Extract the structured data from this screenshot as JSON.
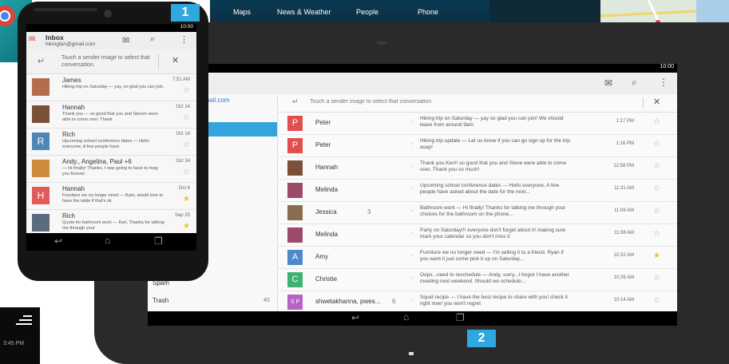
{
  "homescreen": {
    "apps": [
      "Maps",
      "News & Weather",
      "People",
      "Phone"
    ]
  },
  "clock_widget": {
    "time": "3:45 PM"
  },
  "phone": {
    "status_time": "10:00",
    "title": "Inbox",
    "account": "hikingfan@gmail.com",
    "hint": "Touch a sender image to select that conversation.",
    "conversations": [
      {
        "name": "James",
        "date": "7:51 AM",
        "snippet": "Hiking trip on Saturday — yay, so glad you can join.",
        "avatar_letter": "",
        "avatar_color": "#b56d4f",
        "starred": false
      },
      {
        "name": "Hannah",
        "date": "Oct 14",
        "snippet": "Thank you — so good that you and Steven were able to come over. Thank",
        "avatar_letter": "",
        "avatar_color": "#7b5038",
        "starred": false
      },
      {
        "name": "Rich",
        "date": "Oct 14",
        "snippet": "Upcoming school conference dates — Hello everyone, A few people have",
        "avatar_letter": "R",
        "avatar_color": "#4f86b8",
        "starred": false
      },
      {
        "name": "Andy., Angelina, Paul +6",
        "date": "Oct 14",
        "snippet": "— Hi finally! Thanks, I was going to have to mag you forever.",
        "avatar_letter": "",
        "avatar_color": "#d08a3b",
        "starred": false
      },
      {
        "name": "Hannah",
        "date": "Oct 6",
        "snippet": "Furniture we no longer need — Ram, would love to have the table if that's ok",
        "avatar_letter": "H",
        "avatar_color": "#e15a5a",
        "starred": true
      },
      {
        "name": "Rich",
        "date": "Sep 25",
        "snippet": "Quote for bathroom work — Karl, Thanks for talking me through your",
        "avatar_letter": "",
        "avatar_color": "#5a6b7d",
        "starred": true
      }
    ],
    "badge": "1"
  },
  "tablet": {
    "status_time": "10:00",
    "account_partial": "gmail.com",
    "hint": "Touch a sender image to select that conversation.",
    "sidebar": [
      {
        "label": "Spam",
        "count": ""
      },
      {
        "label": "Trash",
        "count": "40"
      }
    ],
    "conversations": [
      {
        "name": "Peter",
        "count": "",
        "time": "1:17 PM",
        "snippet": "Hiking trip on Saturday — yay so glad you can join! We should leave from around 9am.",
        "avatar_letter": "P",
        "avatar_color": "#e04e4e",
        "starred": false,
        "flag": true
      },
      {
        "name": "Peter",
        "count": "",
        "time": "1:16 PM",
        "snippet": "Hiking trip update — Let us know if you can go sign up for the trip asap!",
        "avatar_letter": "P",
        "avatar_color": "#e04e4e",
        "starred": false,
        "flag": true
      },
      {
        "name": "Hannah",
        "count": "",
        "time": "12:58 PM",
        "snippet": "Thank you Ken!! so good that you and Steve were able to come over. Thank you so much!",
        "avatar_letter": "",
        "avatar_color": "#7b5038",
        "starred": false,
        "flag": true
      },
      {
        "name": "Melinda",
        "count": "",
        "time": "11:31 AM",
        "snippet": "Upcoming school conference dates — Hello everyone, A few people have asked about the date for the next...",
        "avatar_letter": "",
        "avatar_color": "#9c4a6a",
        "starred": false,
        "flag": true
      },
      {
        "name": "Jessica",
        "count": "3",
        "time": "11:08 AM",
        "snippet": "Bathroom work — Hi finally! Thanks for talking me through your choices for the bathroom on the phone...",
        "avatar_letter": "",
        "avatar_color": "#8a6d4c",
        "starred": false,
        "flag": true
      },
      {
        "name": "Melinda",
        "count": "",
        "time": "11:08 AM",
        "snippet": "Party on Saturday!!! everyone don't forget about it! making sure mark your calendar so you don't miss it",
        "avatar_letter": "",
        "avatar_color": "#9c4a6a",
        "starred": false,
        "flag": true
      },
      {
        "name": "Amy",
        "count": "",
        "time": "10:32 AM",
        "snippet": "Furniture we no longer need — I'm selling it to a friend. Ryan if you want it just come pick it up on Saturday...",
        "avatar_letter": "A",
        "avatar_color": "#4d8bc6",
        "starred": true,
        "flag": true
      },
      {
        "name": "Christie",
        "count": "",
        "time": "10:26 AM",
        "snippet": "Oops...need to reschedule — Andy, sorry...I forgot I have another meeting next weekend. Should we schedule...",
        "avatar_letter": "C",
        "avatar_color": "#3cb371",
        "starred": false,
        "flag": true
      },
      {
        "name": "shwetakhanna, pwes...",
        "count": "6",
        "time": "10:14 AM",
        "snippet": "Squid recipe — I have the best recipe to share with you! check it right now! you won't regret",
        "avatar_letter": "S P",
        "avatar_color": "#b563c6",
        "starred": false,
        "flag": true
      }
    ],
    "badge": "2"
  }
}
